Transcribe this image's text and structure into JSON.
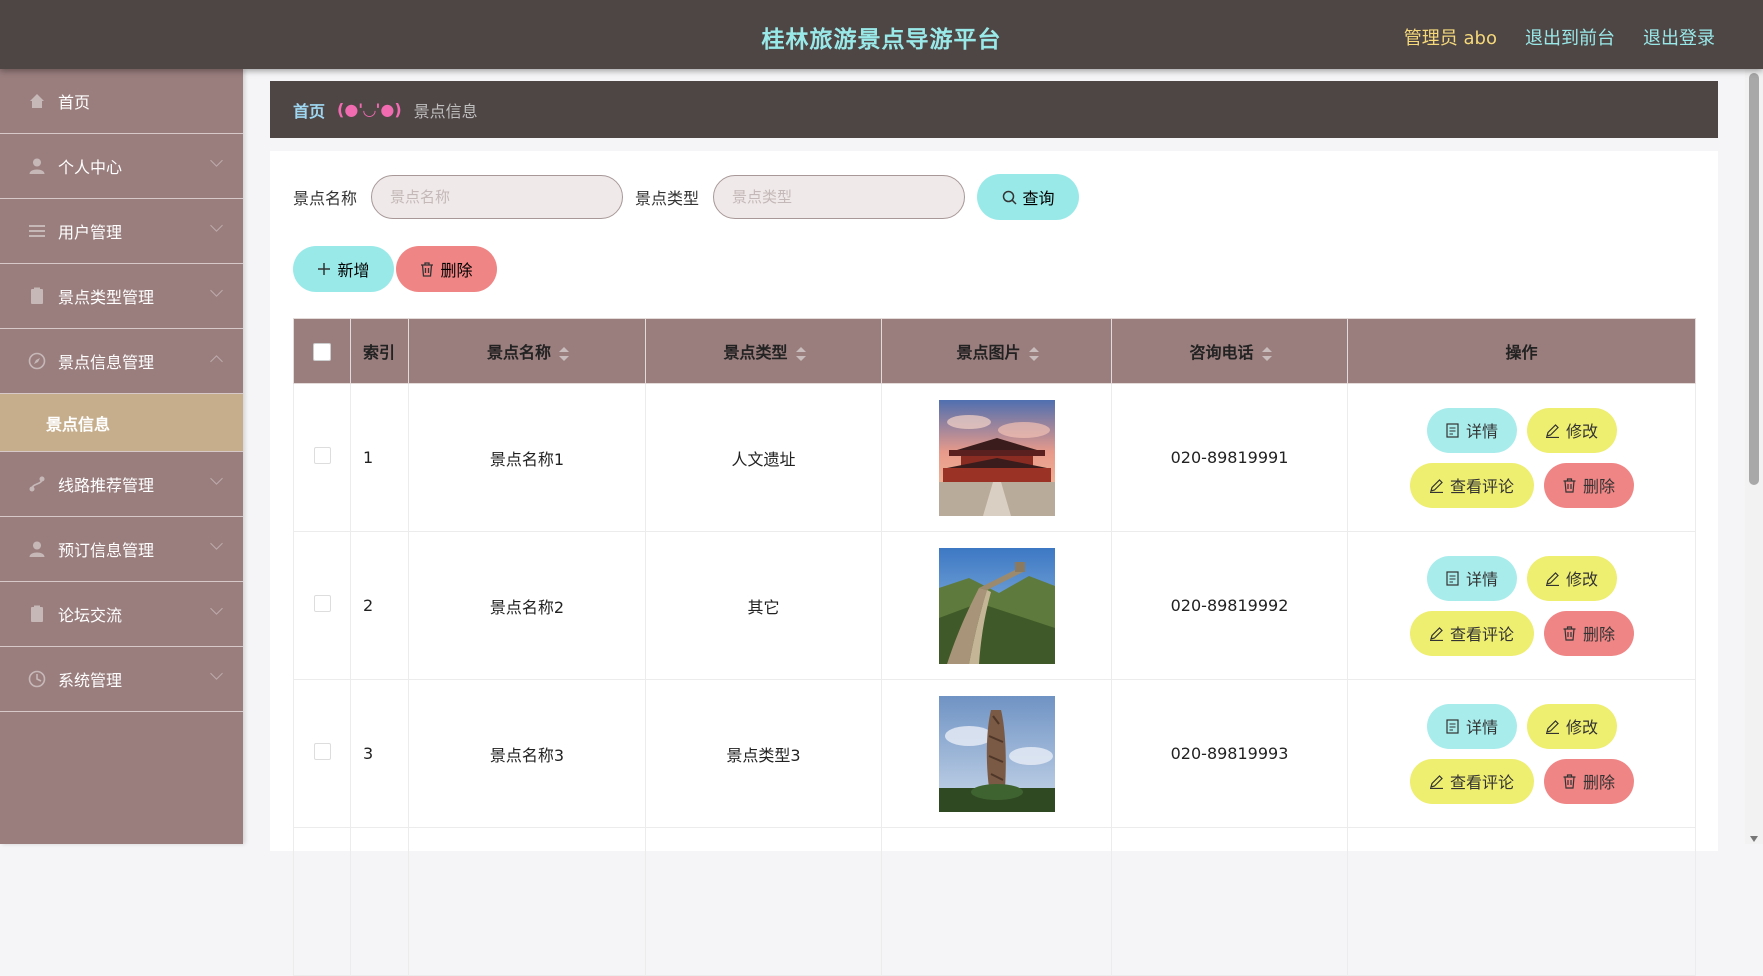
{
  "header": {
    "title": "桂林旅游景点导游平台",
    "admin_label": "管理员 abo",
    "back_to_front": "退出到前台",
    "logout": "退出登录"
  },
  "sidebar": {
    "items": [
      {
        "label": "首页",
        "icon": "home-icon"
      },
      {
        "label": "个人中心",
        "icon": "user-icon"
      },
      {
        "label": "用户管理",
        "icon": "list-icon"
      },
      {
        "label": "景点类型管理",
        "icon": "clipboard-icon"
      },
      {
        "label": "景点信息管理",
        "icon": "compass-icon"
      },
      {
        "label": "线路推荐管理",
        "icon": "route-icon"
      },
      {
        "label": "预订信息管理",
        "icon": "user-icon"
      },
      {
        "label": "论坛交流",
        "icon": "clipboard-icon"
      },
      {
        "label": "系统管理",
        "icon": "clock-icon"
      }
    ],
    "submenu_active": "景点信息"
  },
  "breadcrumb": {
    "home": "首页",
    "face": "(●'◡'●)",
    "current": "景点信息"
  },
  "search": {
    "name_label": "景点名称",
    "name_placeholder": "景点名称",
    "type_label": "景点类型",
    "type_placeholder": "景点类型",
    "query_label": "查询"
  },
  "actions": {
    "add_label": "新增",
    "delete_label": "删除"
  },
  "table": {
    "headers": {
      "index": "索引",
      "name": "景点名称",
      "type": "景点类型",
      "image": "景点图片",
      "phone": "咨询电话",
      "ops": "操作"
    },
    "rows": [
      {
        "index": "1",
        "name": "景点名称1",
        "type": "人文遗址",
        "phone": "020-89819991",
        "image": "palace-photo"
      },
      {
        "index": "2",
        "name": "景点名称2",
        "type": "其它",
        "phone": "020-89819992",
        "image": "great-wall-photo"
      },
      {
        "index": "3",
        "name": "景点名称3",
        "type": "景点类型3",
        "phone": "020-89819993",
        "image": "stone-pillar-photo"
      }
    ],
    "op_labels": {
      "detail": "详情",
      "edit": "修改",
      "comments": "查看评论",
      "delete": "删除"
    }
  },
  "colors": {
    "topbar": "#4e4545",
    "sidebar": "#9a7e7e",
    "accent_cyan": "#9ae9e9",
    "accent_yellow": "#eeee70",
    "accent_red": "#f08585",
    "submenu_active": "#c6ae8c"
  }
}
